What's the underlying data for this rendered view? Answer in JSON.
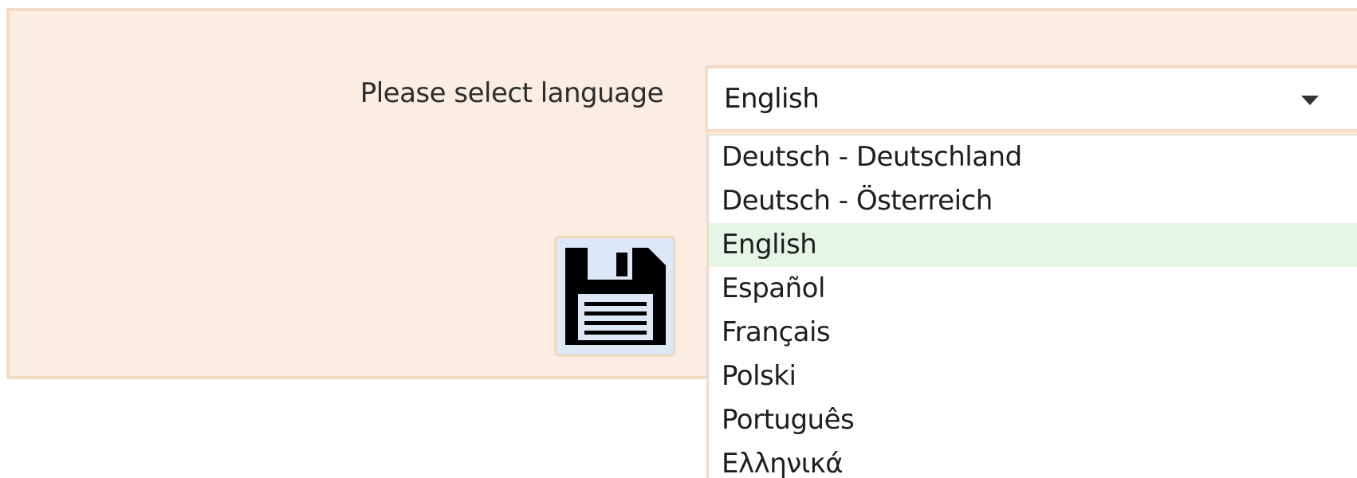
{
  "language_form": {
    "label": "Please select language",
    "selected": "English",
    "options": [
      "Deutsch - Deutschland",
      "Deutsch - Österreich",
      "English",
      "Español",
      "Français",
      "Polski",
      "Português",
      "Ελληνικά"
    ],
    "selected_index": 2
  },
  "icons": {
    "save": "floppy-disk-icon",
    "dropdown": "triangle-down-icon"
  },
  "colors": {
    "panel_background": "#fbede1",
    "panel_border": "#f4dcc4",
    "selected_option": "#e6f6e6",
    "save_button_background": "#dde8f7"
  }
}
